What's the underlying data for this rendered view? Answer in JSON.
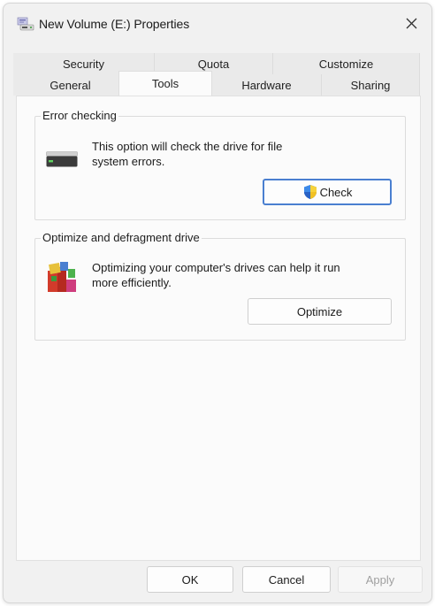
{
  "window": {
    "title": "New Volume (E:) Properties"
  },
  "tabs": {
    "row1": [
      "Security",
      "Quota",
      "Customize"
    ],
    "row2": [
      "General",
      "Tools",
      "Hardware",
      "Sharing"
    ],
    "active": "Tools"
  },
  "error_checking": {
    "title": "Error checking",
    "description_line1": "This option will check the drive for file",
    "description_line2": "system errors.",
    "button_label": "Check",
    "drive_icon": "drive-icon",
    "shield_icon": "uac-shield-icon"
  },
  "optimize": {
    "title": "Optimize and defragment drive",
    "description_line1": "Optimizing your computer's drives can help it run",
    "description_line2": "more efficiently.",
    "button_label": "Optimize",
    "icon": "defragment-icon"
  },
  "footer": {
    "ok_label": "OK",
    "cancel_label": "Cancel",
    "apply_label": "Apply"
  },
  "colors": {
    "accent": "#4a7fd0",
    "window_bg": "#f1f1f1",
    "panel_bg": "#fbfbfb"
  }
}
